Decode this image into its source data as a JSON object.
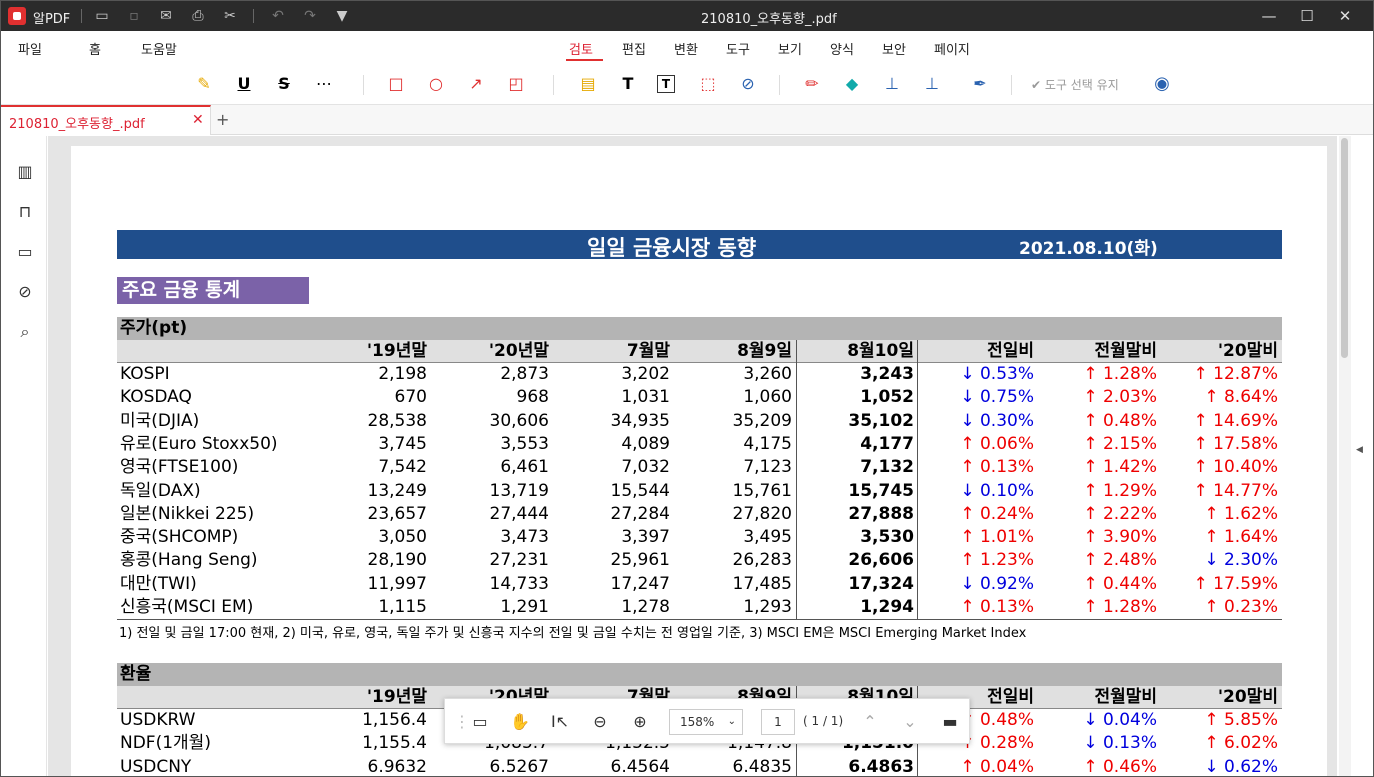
{
  "app": {
    "name": "알PDF",
    "doc_title": "210810_오후동향_.pdf"
  },
  "menu": [
    "파일",
    "홈",
    "도움말",
    "검토",
    "편집",
    "변환",
    "도구",
    "보기",
    "양식",
    "보안",
    "페이지"
  ],
  "toolbar": {
    "keep_selection": "도구 선택 유지"
  },
  "tab": {
    "label": "210810_오후동향_.pdf",
    "add": "+"
  },
  "report": {
    "title": "일일 금융시장 동향",
    "date": "2021.08.10(화)",
    "section": "주요 금융 통계"
  },
  "stocks": {
    "group": "주가(pt)",
    "headers": [
      "'19년말",
      "'20년말",
      "7월말",
      "8월9일",
      "8월10일",
      "전일비",
      "전월말비",
      "'20말비"
    ],
    "rows": [
      {
        "name": "KOSPI",
        "v": [
          "2,198",
          "2,873",
          "3,202",
          "3,260",
          "3,243"
        ],
        "c": [
          [
            "↓ 0.53%",
            "dn"
          ],
          [
            "↑ 1.28%",
            "up"
          ],
          [
            "↑ 12.87%",
            "up"
          ]
        ]
      },
      {
        "name": "KOSDAQ",
        "v": [
          "670",
          "968",
          "1,031",
          "1,060",
          "1,052"
        ],
        "c": [
          [
            "↓ 0.75%",
            "dn"
          ],
          [
            "↑ 2.03%",
            "up"
          ],
          [
            "↑ 8.64%",
            "up"
          ]
        ]
      },
      {
        "name": "미국(DJIA)",
        "v": [
          "28,538",
          "30,606",
          "34,935",
          "35,209",
          "35,102"
        ],
        "c": [
          [
            "↓ 0.30%",
            "dn"
          ],
          [
            "↑ 0.48%",
            "up"
          ],
          [
            "↑ 14.69%",
            "up"
          ]
        ]
      },
      {
        "name": "유로(Euro Stoxx50)",
        "v": [
          "3,745",
          "3,553",
          "4,089",
          "4,175",
          "4,177"
        ],
        "c": [
          [
            "↑ 0.06%",
            "up"
          ],
          [
            "↑ 2.15%",
            "up"
          ],
          [
            "↑ 17.58%",
            "up"
          ]
        ]
      },
      {
        "name": "영국(FTSE100)",
        "v": [
          "7,542",
          "6,461",
          "7,032",
          "7,123",
          "7,132"
        ],
        "c": [
          [
            "↑ 0.13%",
            "up"
          ],
          [
            "↑ 1.42%",
            "up"
          ],
          [
            "↑ 10.40%",
            "up"
          ]
        ]
      },
      {
        "name": "독일(DAX)",
        "v": [
          "13,249",
          "13,719",
          "15,544",
          "15,761",
          "15,745"
        ],
        "c": [
          [
            "↓ 0.10%",
            "dn"
          ],
          [
            "↑ 1.29%",
            "up"
          ],
          [
            "↑ 14.77%",
            "up"
          ]
        ]
      },
      {
        "name": "일본(Nikkei 225)",
        "v": [
          "23,657",
          "27,444",
          "27,284",
          "27,820",
          "27,888"
        ],
        "c": [
          [
            "↑ 0.24%",
            "up"
          ],
          [
            "↑ 2.22%",
            "up"
          ],
          [
            "↑ 1.62%",
            "up"
          ]
        ]
      },
      {
        "name": "중국(SHCOMP)",
        "v": [
          "3,050",
          "3,473",
          "3,397",
          "3,495",
          "3,530"
        ],
        "c": [
          [
            "↑ 1.01%",
            "up"
          ],
          [
            "↑ 3.90%",
            "up"
          ],
          [
            "↑ 1.64%",
            "up"
          ]
        ]
      },
      {
        "name": "홍콩(Hang Seng)",
        "v": [
          "28,190",
          "27,231",
          "25,961",
          "26,283",
          "26,606"
        ],
        "c": [
          [
            "↑ 1.23%",
            "up"
          ],
          [
            "↑ 2.48%",
            "up"
          ],
          [
            "↓ 2.30%",
            "dn"
          ]
        ]
      },
      {
        "name": "대만(TWI)",
        "v": [
          "11,997",
          "14,733",
          "17,247",
          "17,485",
          "17,324"
        ],
        "c": [
          [
            "↓ 0.92%",
            "dn"
          ],
          [
            "↑ 0.44%",
            "up"
          ],
          [
            "↑ 17.59%",
            "up"
          ]
        ]
      },
      {
        "name": "신흥국(MSCI EM)",
        "v": [
          "1,115",
          "1,291",
          "1,278",
          "1,293",
          "1,294"
        ],
        "c": [
          [
            "↑ 0.13%",
            "up"
          ],
          [
            "↑ 1.28%",
            "up"
          ],
          [
            "↑ 0.23%",
            "up"
          ]
        ]
      }
    ]
  },
  "note": "1) 전일 및 금일 17:00 현재,  2) 미국, 유로, 영국, 독일 주가 및 신흥국 지수의 전일 및 금일 수치는 전 영업일 기준, 3) MSCI EM은 MSCI Emerging Market Index",
  "fx": {
    "group": "환율",
    "headers": [
      "'19년말",
      "'20년말",
      "7월말",
      "8월9일",
      "8월10일",
      "전일비",
      "전월말비",
      "'20말비"
    ],
    "rows": [
      {
        "name": "USDKRW",
        "v": [
          "1,156.4",
          "",
          "",
          "",
          ""
        ],
        "c": [
          [
            "↑ 0.48%",
            "up"
          ],
          [
            "↓ 0.04%",
            "dn"
          ],
          [
            "↑ 5.85%",
            "up"
          ]
        ]
      },
      {
        "name": "  NDF(1개월)",
        "v": [
          "1,155.4",
          "1,085.7",
          "1,152.5",
          "1,147.8",
          "1,151.0"
        ],
        "c": [
          [
            "↑ 0.28%",
            "up"
          ],
          [
            "↓ 0.13%",
            "dn"
          ],
          [
            "↑ 6.02%",
            "up"
          ]
        ]
      },
      {
        "name": "USDCNY",
        "v": [
          "6.9632",
          "6.5267",
          "6.4564",
          "6.4835",
          "6.4863"
        ],
        "c": [
          [
            "↑ 0.04%",
            "up"
          ],
          [
            "↑ 0.46%",
            "up"
          ],
          [
            "↓ 0.62%",
            "dn"
          ]
        ]
      }
    ]
  },
  "floatbar": {
    "zoom": "158%",
    "page": "1",
    "count": "( 1 / 1)"
  }
}
